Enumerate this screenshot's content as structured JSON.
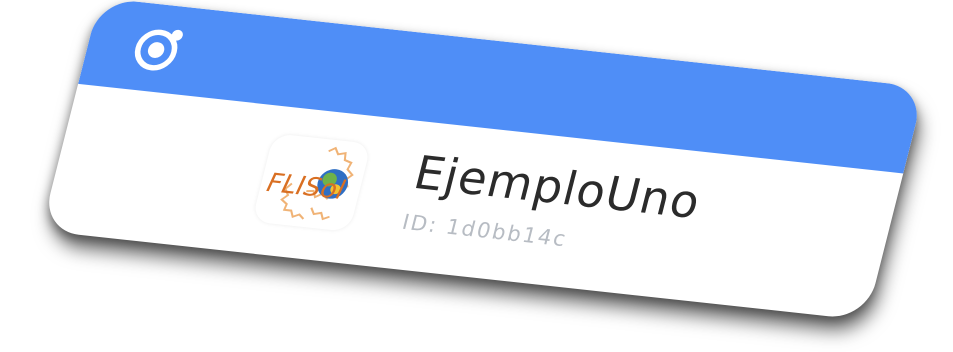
{
  "header": {
    "logo_icon": "ionic-logo-icon",
    "color": "#4f8ef7"
  },
  "app": {
    "icon": "flisol-logo-icon",
    "name": "EjemploUno",
    "id_text": "ID: 1d0bb14c"
  }
}
